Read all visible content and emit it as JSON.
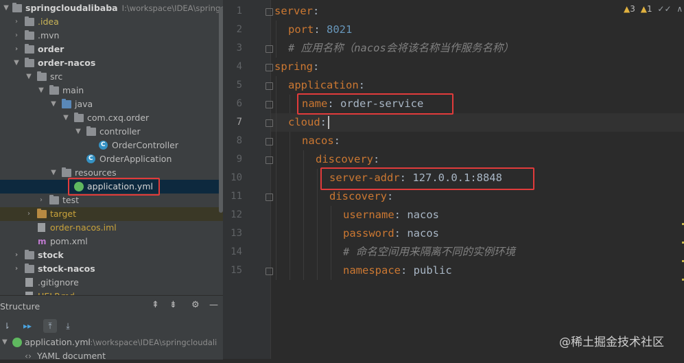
{
  "project_tree": {
    "items": [
      {
        "label": "springcloudalibaba",
        "path": "I:\\workspace\\IDEA\\springclo"
      },
      {
        "label": ".idea"
      },
      {
        "label": ".mvn"
      },
      {
        "label": "order"
      },
      {
        "label": "order-nacos"
      },
      {
        "label": "src"
      },
      {
        "label": "main"
      },
      {
        "label": "java"
      },
      {
        "label": "com.cxq.order"
      },
      {
        "label": "controller"
      },
      {
        "label": "OrderController"
      },
      {
        "label": "OrderApplication"
      },
      {
        "label": "resources"
      },
      {
        "label": "application.yml"
      },
      {
        "label": "test"
      },
      {
        "label": "target"
      },
      {
        "label": "order-nacos.iml"
      },
      {
        "label": "pom.xml"
      },
      {
        "label": "stock"
      },
      {
        "label": "stock-nacos"
      },
      {
        "label": ".gitignore"
      },
      {
        "label": "HELP.md"
      }
    ]
  },
  "structure": {
    "title": "Structure",
    "file_label": "application.yml",
    "file_path": "I:\\workspace\\IDEA\\springcloudali",
    "doc_label": "YAML document"
  },
  "inspections": {
    "warnings": "3",
    "typos": "1"
  },
  "line_numbers": [
    "1",
    "2",
    "3",
    "4",
    "5",
    "6",
    "7",
    "8",
    "9",
    "10",
    "11",
    "12",
    "13",
    "14",
    "15"
  ],
  "code": {
    "l1_key": "server",
    "l1_colon": ":",
    "l2_key": "port",
    "l2_colon": ": ",
    "l2_val": "8021",
    "l3_comment": "# 应用名称（nacos会将该名称当作服务名称）",
    "l4_key": "spring",
    "l4_colon": ":",
    "l5_key": "application",
    "l5_colon": ":",
    "l6_key": "name",
    "l6_colon": ": ",
    "l6_val": "order-service",
    "l7_key": "cloud",
    "l7_colon": ":",
    "l8_key": "nacos",
    "l8_colon": ":",
    "l9_key": "discovery",
    "l9_colon": ":",
    "l10_key": "server-addr",
    "l10_colon": ": ",
    "l10_val": "127.0.0.1:8848",
    "l11_key": "discovery",
    "l11_colon": ":",
    "l12_key": "username",
    "l12_colon": ": ",
    "l12_val": "nacos",
    "l13_key": "password",
    "l13_colon": ": ",
    "l13_val": "nacos",
    "l14_comment": "# 命名空间用来隔离不同的实例环境",
    "l15_key": "namespace",
    "l15_colon": ": ",
    "l15_val": "public"
  },
  "watermark": "@稀土掘金技术社区"
}
